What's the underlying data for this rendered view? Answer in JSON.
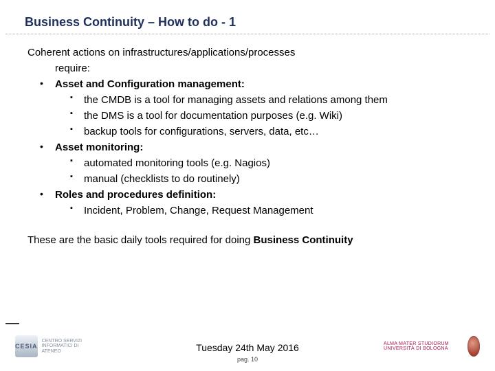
{
  "title": "Business Continuity – How to do - 1",
  "intro_line1": "Coherent actions on infrastructures/applications/processes",
  "intro_line2": "require:",
  "items": [
    {
      "label": "Asset and Configuration management:",
      "subs": [
        "the CMDB is a tool for managing assets and relations among them",
        "the DMS is a tool for documentation purposes (e.g. Wiki)",
        "backup tools for configurations, servers, data, etc…"
      ]
    },
    {
      "label": "Asset monitoring:",
      "subs": [
        "automated monitoring tools (e.g. Nagios)",
        "manual (checklists to do routinely)"
      ]
    },
    {
      "label": "Roles and procedures definition:",
      "subs": [
        "Incident, Problem, Change, Request Management"
      ]
    }
  ],
  "closing_pre": "These are the basic daily tools required for doing ",
  "closing_bold": "Business Continuity",
  "footer": {
    "date": "Tuesday 24th May 2016",
    "page": "pag. 10"
  },
  "logos": {
    "left_mark": "CESIA",
    "left_txt": "CENTRO SERVIZI\nINFORMATICI DI ATENEO",
    "right_txt": "ALMA MATER STUDIORUM\nUNIVERSITÀ DI BOLOGNA"
  }
}
